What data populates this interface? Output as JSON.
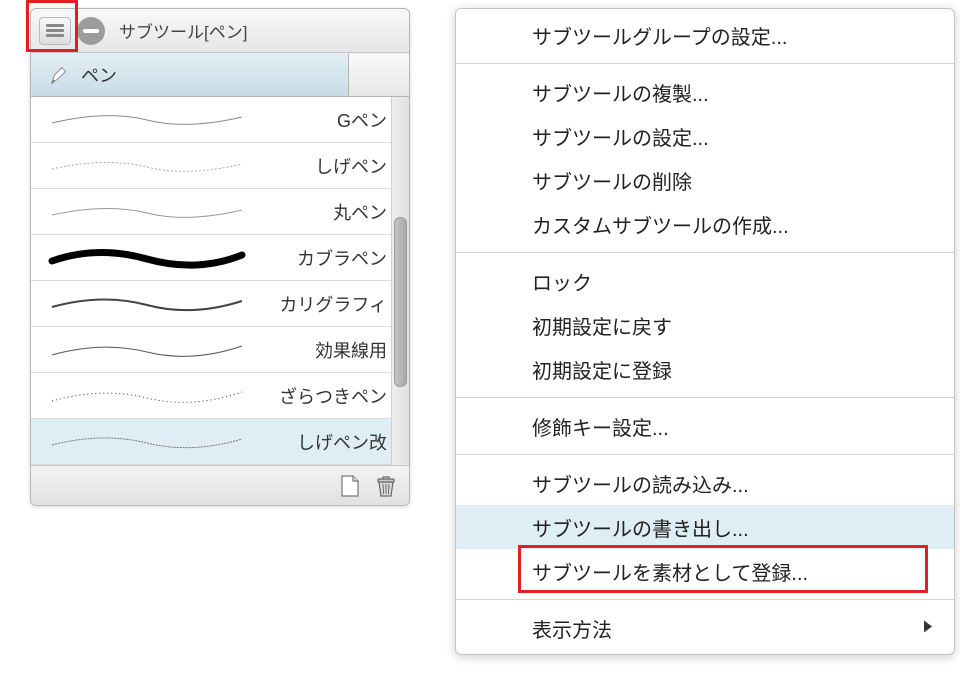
{
  "panel": {
    "title": "サブツール[ペン]",
    "tab_label": "ペン",
    "tools": [
      {
        "label": "Gペン"
      },
      {
        "label": "しげペン"
      },
      {
        "label": "丸ペン"
      },
      {
        "label": "カブラペン"
      },
      {
        "label": "カリグラフィ"
      },
      {
        "label": "効果線用"
      },
      {
        "label": "ざらつきペン"
      },
      {
        "label": "しげペン改"
      }
    ],
    "selected_index": 7
  },
  "menu": {
    "items": [
      {
        "label": "サブツールグループの設定..."
      },
      {
        "sep": true
      },
      {
        "label": "サブツールの複製..."
      },
      {
        "label": "サブツールの設定..."
      },
      {
        "label": "サブツールの削除"
      },
      {
        "label": "カスタムサブツールの作成..."
      },
      {
        "sep": true
      },
      {
        "label": "ロック"
      },
      {
        "label": "初期設定に戻す"
      },
      {
        "label": "初期設定に登録"
      },
      {
        "sep": true
      },
      {
        "label": "修飾キー設定..."
      },
      {
        "sep": true
      },
      {
        "label": "サブツールの読み込み..."
      },
      {
        "label": "サブツールの書き出し...",
        "highlighted": true
      },
      {
        "label": "サブツールを素材として登録..."
      },
      {
        "sep": true
      },
      {
        "label": "表示方法",
        "submenu": true
      }
    ]
  }
}
